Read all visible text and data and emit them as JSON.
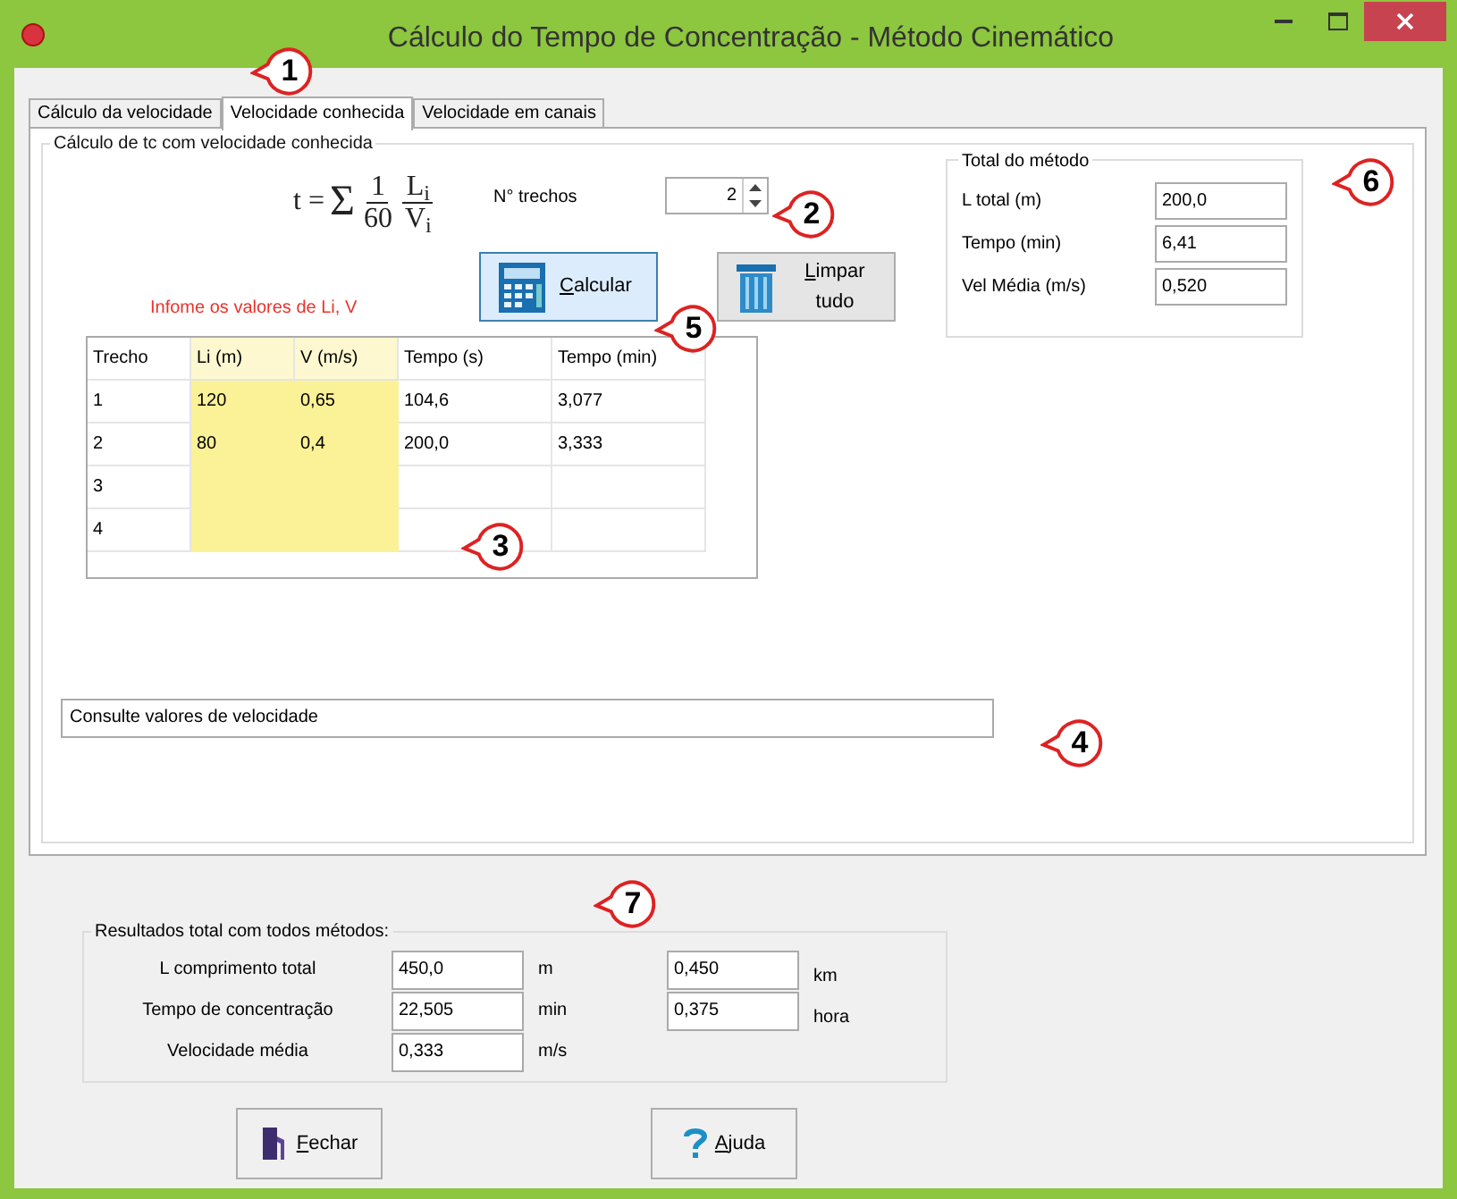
{
  "window": {
    "title": "Cálculo do Tempo de Concentração - Método Cinemático"
  },
  "tabs": [
    {
      "label": "Cálculo da velocidade",
      "selected": false
    },
    {
      "label": "Velocidade conhecida",
      "selected": true
    },
    {
      "label": "Velocidade em canais",
      "selected": false
    }
  ],
  "panel": {
    "title": "Cálculo  de tc com velocidade conhecida",
    "formula": {
      "lhs": "t =",
      "sum": "Σ",
      "num1": "1",
      "den1": "60",
      "num2": "L$_{i}$",
      "den2": "V$_{i}$"
    },
    "trechos_label": "N° trechos",
    "trechos_value": "2",
    "hint": "Infome os valores de Li, V",
    "buttons": [
      {
        "label": "Calcular",
        "kind": "calc",
        "selected": true
      },
      {
        "label": "Limpar tudo",
        "kind": "clear",
        "selected": false
      }
    ],
    "total": {
      "title": "Total do método",
      "rows": [
        {
          "label": "L total (m)",
          "value": "200,0"
        },
        {
          "label": "Tempo (min)",
          "value": "6,41"
        },
        {
          "label": "Vel Média (m/s)",
          "value": "0,520"
        }
      ]
    },
    "table": {
      "columns": [
        {
          "label": "Trecho",
          "input": false
        },
        {
          "label": "Li (m)",
          "input": true
        },
        {
          "label": "V (m/s)",
          "input": true
        },
        {
          "label": "Tempo (s)",
          "input": false
        },
        {
          "label": "Tempo (min)",
          "input": false
        }
      ],
      "rows": [
        [
          "1",
          "120",
          "0,65",
          "104,6",
          "3,077"
        ],
        [
          "2",
          "80",
          "0,4",
          "200,0",
          "3,333"
        ],
        [
          "3",
          "",
          "",
          "",
          ""
        ],
        [
          "4",
          "",
          "",
          "",
          ""
        ]
      ]
    },
    "velocity_lookup": {
      "value": "Consulte valores de velocidade"
    }
  },
  "results": {
    "title": "Resultados total com todos métodos:",
    "rows": [
      {
        "label": "L comprimento total",
        "value": "450,0",
        "unit": "m",
        "value2": "0,450",
        "unit2": "km"
      },
      {
        "label": "Tempo de concentração",
        "value": "22,505",
        "unit": "min",
        "value2": "0,375",
        "unit2": "hora"
      },
      {
        "label": "Velocidade média",
        "value": "0,333",
        "unit": "m/s"
      }
    ]
  },
  "footer_buttons": [
    {
      "label": "Fechar",
      "kind": "close"
    },
    {
      "label": "Ajuda",
      "kind": "help"
    }
  ],
  "callouts": [
    {
      "number": "1"
    },
    {
      "number": "2"
    },
    {
      "number": "3"
    },
    {
      "number": "4"
    },
    {
      "number": "5"
    },
    {
      "number": "6"
    },
    {
      "number": "7"
    }
  ]
}
